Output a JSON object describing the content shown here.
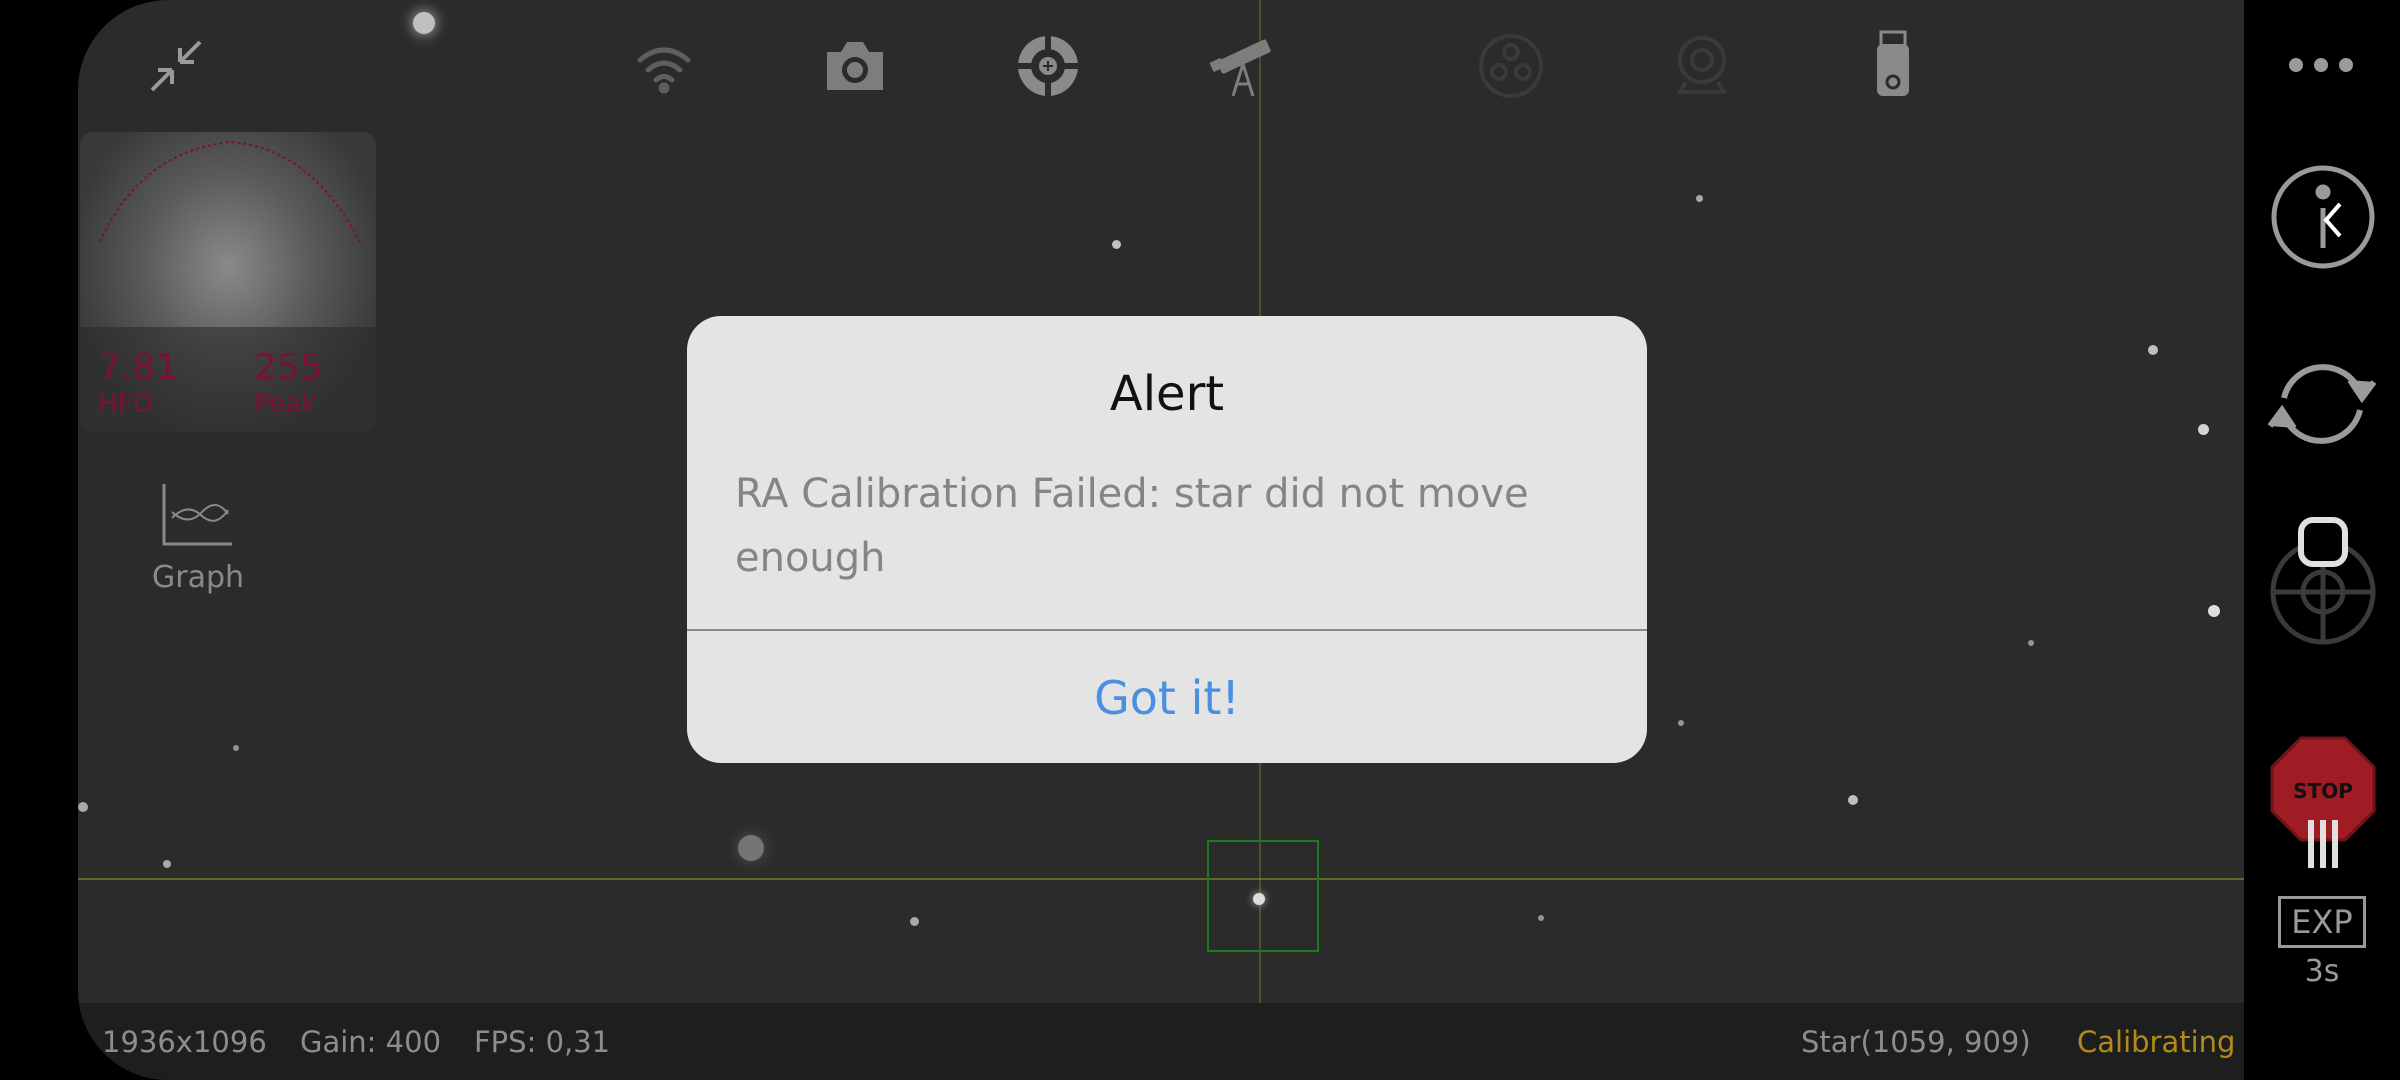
{
  "toolbar": {
    "icons": [
      "collapse-icon",
      "wifi-icon",
      "camera-icon",
      "guide-target-icon",
      "telescope-icon",
      "filter-wheel-icon",
      "focuser-icon",
      "usb-drive-icon"
    ]
  },
  "hfd_panel": {
    "hfd_value": "7.81",
    "hfd_label": "HFD",
    "peak_value": "255",
    "peak_label": "Peak"
  },
  "graph": {
    "label": "Graph"
  },
  "status": {
    "resolution": "1936x1096",
    "gain": "Gain: 400",
    "fps": "FPS: 0,31",
    "star": "Star(1059, 909)",
    "state": "Calibrating"
  },
  "right_panel": {
    "menu": "more-dots-icon",
    "exposure_label": "EXP",
    "exposure_value": "3s",
    "stop_label": "STOP"
  },
  "dialog": {
    "title": "Alert",
    "message": "RA Calibration Failed: star did not move enough",
    "button": "Got it!"
  },
  "colors": {
    "accent_blue": "#4a8fe0",
    "calibrating": "#b08a1a",
    "hfd_text": "#7a1230",
    "stop_red": "#a01c24"
  }
}
